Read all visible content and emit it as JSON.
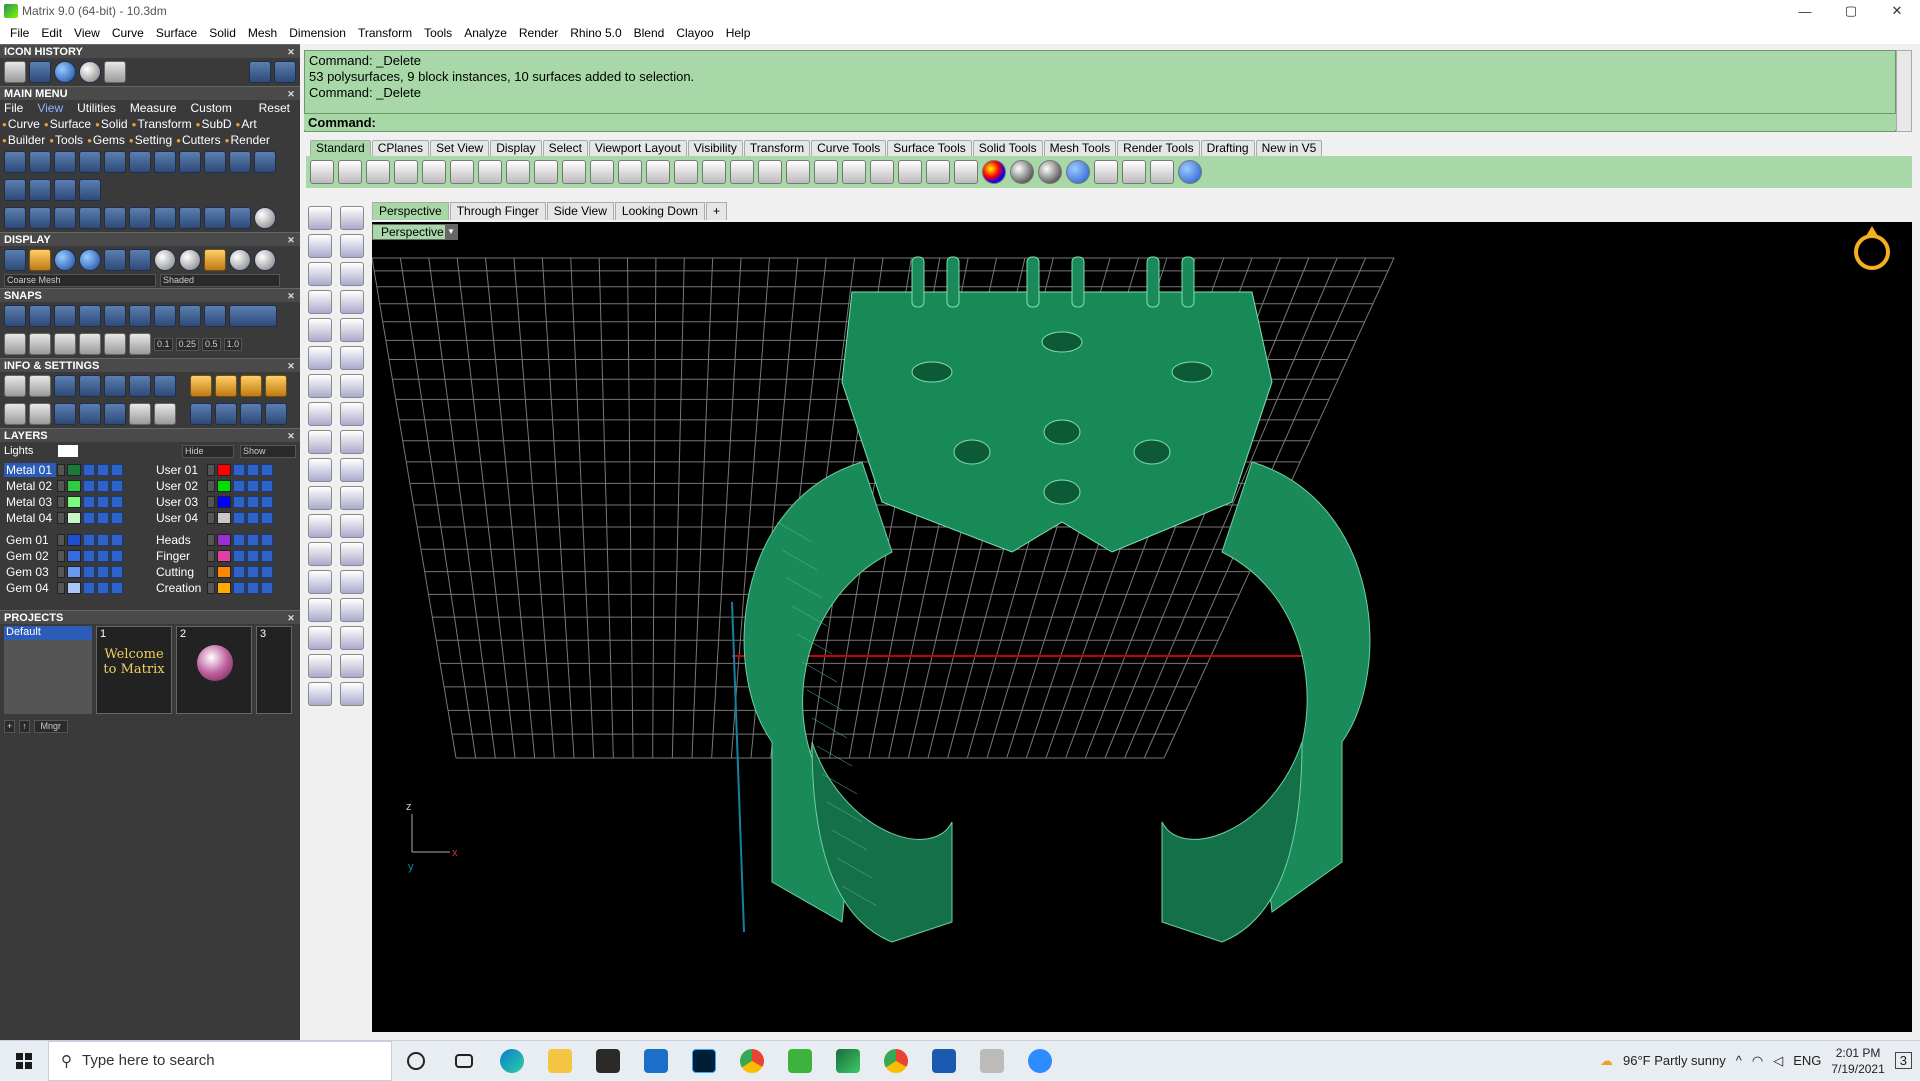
{
  "window": {
    "title": "Matrix 9.0 (64-bit) - 10.3dm",
    "controls": [
      "—",
      "▢",
      "✕"
    ]
  },
  "menubar": [
    "File",
    "Edit",
    "View",
    "Curve",
    "Surface",
    "Solid",
    "Mesh",
    "Dimension",
    "Transform",
    "Tools",
    "Analyze",
    "Render",
    "Rhino 5.0",
    "Blend",
    "Clayoo",
    "Help"
  ],
  "left": {
    "icon_history": "ICON HISTORY",
    "main_menu": {
      "title": "MAIN MENU",
      "links": [
        "File",
        "View",
        "Utilities",
        "Measure",
        "Custom"
      ],
      "active_link": "View",
      "reset": "Reset",
      "row1": [
        "Curve",
        "Surface",
        "Solid",
        "Transform",
        "SubD",
        "Art"
      ],
      "row2": [
        "Builder",
        "Tools",
        "Gems",
        "Setting",
        "Cutters",
        "Render"
      ]
    },
    "display": {
      "title": "DISPLAY",
      "mesh_select": "Coarse Mesh",
      "shade_select": "Shaded"
    },
    "snaps": {
      "title": "SNAPS",
      "values": [
        "0.1",
        "0.25",
        "0.5",
        "1.0"
      ]
    },
    "info": {
      "title": "INFO & SETTINGS"
    },
    "layers": {
      "title": "LAYERS",
      "lights": "Lights",
      "hide": "Hide",
      "show": "Show",
      "col1": [
        {
          "name": "Metal 01",
          "color": "#1a7a3a",
          "selected": true
        },
        {
          "name": "Metal 02",
          "color": "#2ecc40"
        },
        {
          "name": "Metal 03",
          "color": "#7cfc7c"
        },
        {
          "name": "Metal 04",
          "color": "#c8f8c8"
        },
        {
          "name": "Gem 01",
          "color": "#1f4fd0"
        },
        {
          "name": "Gem 02",
          "color": "#3a6ae0"
        },
        {
          "name": "Gem 03",
          "color": "#6a9af0"
        },
        {
          "name": "Gem 04",
          "color": "#aac8f8"
        }
      ],
      "col2": [
        {
          "name": "User 01",
          "color": "#ff0000"
        },
        {
          "name": "User 02",
          "color": "#00e000"
        },
        {
          "name": "User 03",
          "color": "#0000ff"
        },
        {
          "name": "User 04",
          "color": "#c8c8c8"
        },
        {
          "name": "Heads",
          "color": "#9a30d0"
        },
        {
          "name": "Finger",
          "color": "#e040a0"
        },
        {
          "name": "Cutting",
          "color": "#ff8800"
        },
        {
          "name": "Creation",
          "color": "#ffaa00"
        }
      ]
    },
    "projects": {
      "title": "PROJECTS",
      "list": [
        "Default"
      ],
      "thumbs": [
        "1",
        "2",
        "3"
      ],
      "welcome": "Welcome to Matrix",
      "mngr": "Mngr"
    }
  },
  "command": {
    "history": [
      "Command: _Delete",
      "53 polysurfaces, 9 block instances, 10 surfaces added to selection.",
      "Command: _Delete"
    ],
    "prompt": "Command:"
  },
  "toolbar_tabs": [
    "Standard",
    "CPlanes",
    "Set View",
    "Display",
    "Select",
    "Viewport Layout",
    "Visibility",
    "Transform",
    "Curve Tools",
    "Surface Tools",
    "Solid Tools",
    "Mesh Tools",
    "Render Tools",
    "Drafting",
    "New in V5"
  ],
  "active_toolbar_tab": "Standard",
  "view_tabs": [
    "Perspective",
    "Through Finger",
    "Side View",
    "Looking Down",
    "+"
  ],
  "active_view_tab": "Perspective",
  "viewport": {
    "label": "Perspective",
    "axis_z": "z",
    "axis_x": "x",
    "axis_y": "y",
    "model_color": "#1a8a5a"
  },
  "taskbar": {
    "search_placeholder": "Type here to search",
    "weather": "96°F  Partly sunny",
    "lang": "ENG",
    "time": "2:01 PM",
    "date": "7/19/2021",
    "notif": "3"
  }
}
